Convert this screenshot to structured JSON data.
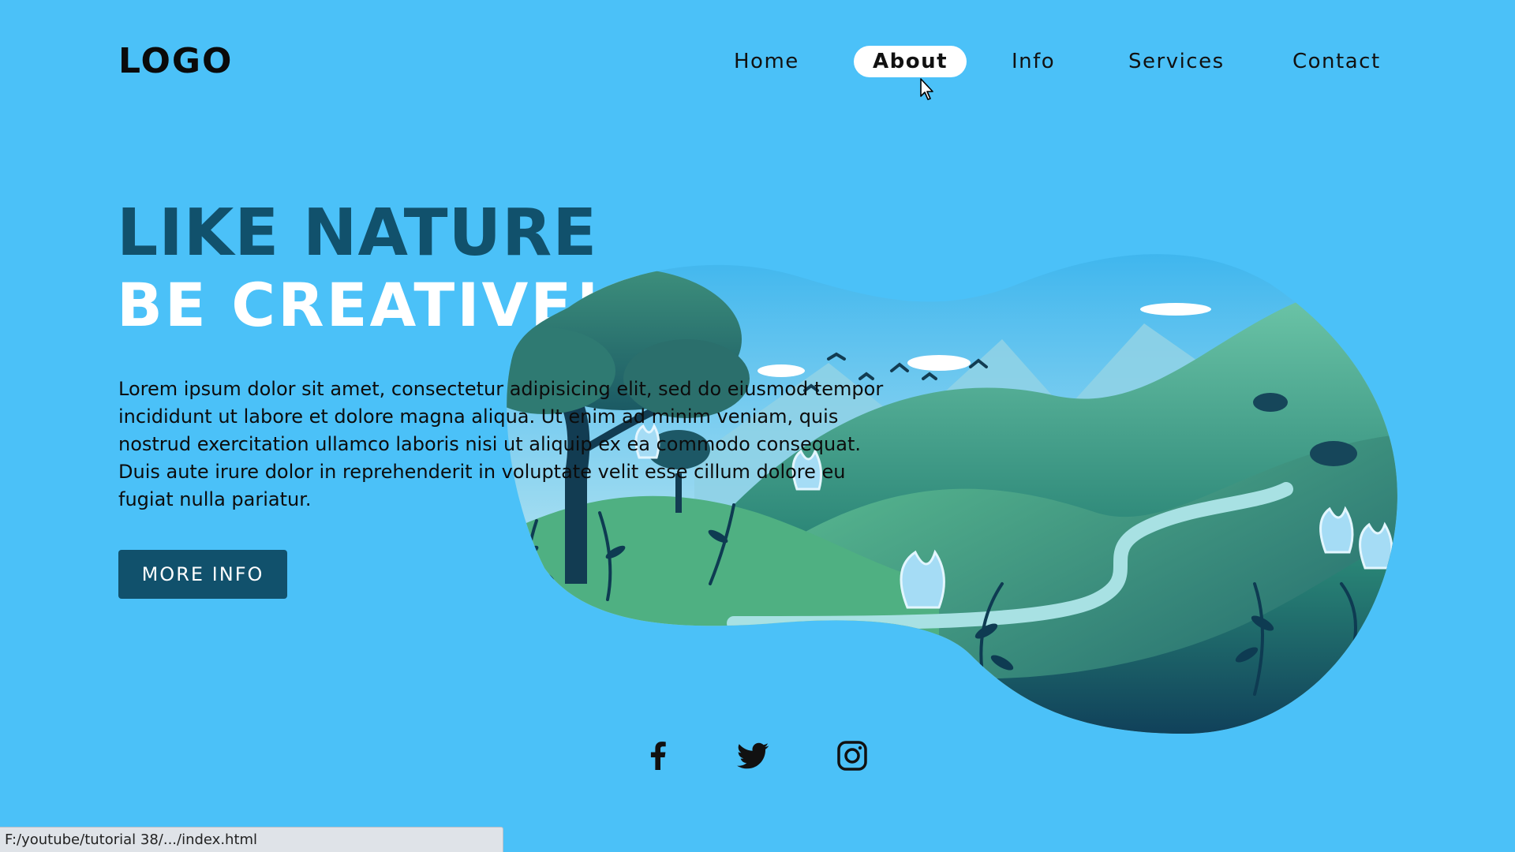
{
  "header": {
    "logo": "LOGO",
    "nav": [
      {
        "label": "Home",
        "active": false
      },
      {
        "label": "About",
        "active": true
      },
      {
        "label": "Info",
        "active": false
      },
      {
        "label": "Services",
        "active": false
      },
      {
        "label": "Contact",
        "active": false
      }
    ]
  },
  "hero": {
    "title_line1": "LIKE NATURE",
    "title_line2": "BE CREATIVE!",
    "body": "Lorem ipsum dolor sit amet, consectetur adipisicing elit, sed do eiusmod tempor incididunt ut labore et dolore magna aliqua. Ut enim ad minim veniam, quis nostrud exercitation ullamco laboris nisi ut aliquip ex ea commodo consequat. Duis aute irure dolor in reprehenderit in voluptate velit esse cillum dolore eu fugiat nulla pariatur.",
    "button_label": "MORE INFO"
  },
  "social": [
    {
      "icon": "facebook-icon"
    },
    {
      "icon": "twitter-icon"
    },
    {
      "icon": "instagram-icon"
    }
  ],
  "status_bar": {
    "url": "F:/youtube/tutorial 38/.../index.html"
  },
  "colors": {
    "background": "#4bc1f8",
    "accent_dark": "#11516c",
    "white": "#ffffff"
  }
}
